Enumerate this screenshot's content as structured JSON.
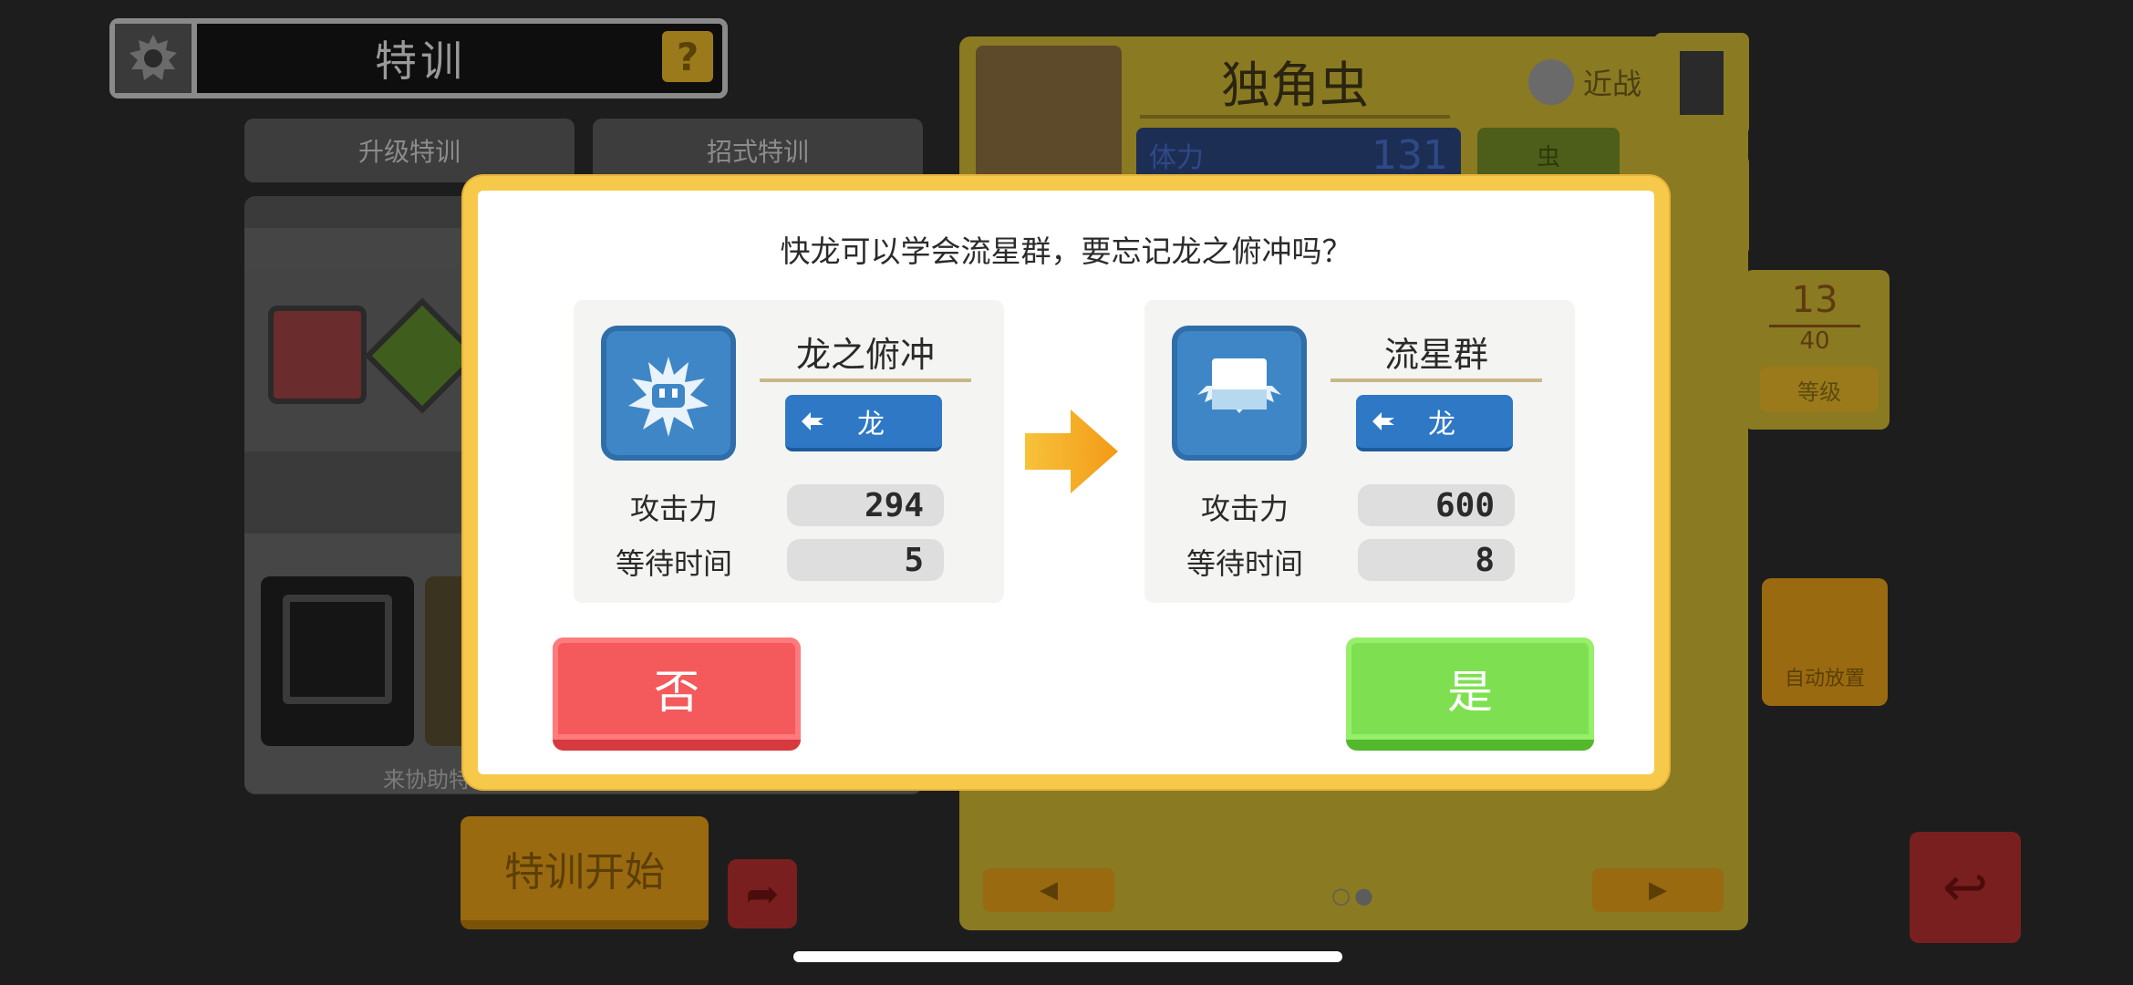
{
  "background": {
    "screen_title": "特训",
    "help_symbol": "?",
    "tabs": [
      "升级特训",
      "招式特训"
    ],
    "left_footer": "来协助特",
    "start_button": "特训开始",
    "card": {
      "name": "独角虫",
      "combat_style": "近战",
      "hp_label": "体力",
      "hp_value": "131",
      "type_tag": "虫",
      "level": "13",
      "level_max": "40",
      "level_label": "等级",
      "auto_place_label": "自动放置"
    }
  },
  "dialog": {
    "prompt": "快龙可以学会流星群，要忘记龙之俯冲吗？",
    "old_move": {
      "name": "龙之俯冲",
      "type": "龙",
      "attack_label": "攻击力",
      "attack": "294",
      "wait_label": "等待时间",
      "wait": "5"
    },
    "new_move": {
      "name": "流星群",
      "type": "龙",
      "attack_label": "攻击力",
      "attack": "600",
      "wait_label": "等待时间",
      "wait": "8"
    },
    "no_button": "否",
    "yes_button": "是"
  },
  "colors": {
    "dialog_border": "#f6c94a",
    "dragon_type": "#2e78c6",
    "no_button": "#f4595b",
    "yes_button": "#7ee050",
    "arrow": "#f5b324"
  }
}
